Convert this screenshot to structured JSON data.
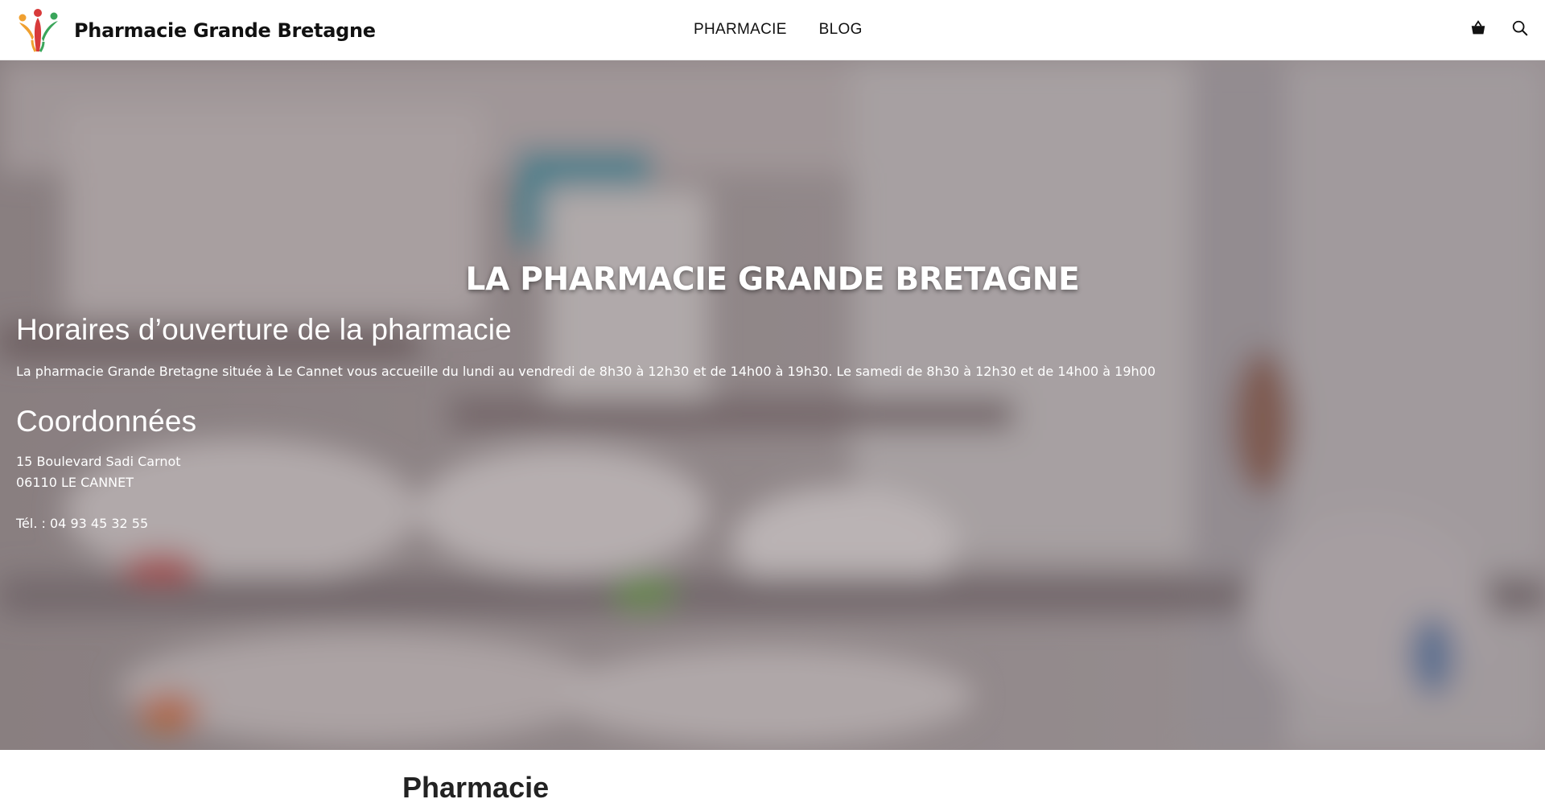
{
  "header": {
    "site_title": "Pharmacie Grande Bretagne",
    "nav": [
      {
        "label": "PHARMACIE"
      },
      {
        "label": "BLOG"
      }
    ],
    "icons": [
      "shopping-basket-icon",
      "search-icon"
    ]
  },
  "hero": {
    "title": "LA PHARMACIE GRANDE BRETAGNE",
    "hours_heading": "Horaires d’ouverture de la pharmacie",
    "hours_text": "La pharmacie Grande Bretagne située à Le Cannet vous accueille du lundi au vendredi de 8h30 à 12h30 et de 14h00 à 19h30. Le samedi de 8h30 à 12h30 et de 14h00 à 19h00",
    "coords_heading": "Coordonnées",
    "address_line1": "15 Boulevard Sadi Carnot",
    "address_line2": "06110 LE CANNET",
    "phone": "Tél. : 04 93 45 32 55"
  },
  "section": {
    "title": "Pharmacie"
  },
  "colors": {
    "logo_red": "#d83a3a",
    "logo_orange": "#f0a030",
    "logo_green": "#3aa55a",
    "hero_tint": "#8e8486"
  }
}
